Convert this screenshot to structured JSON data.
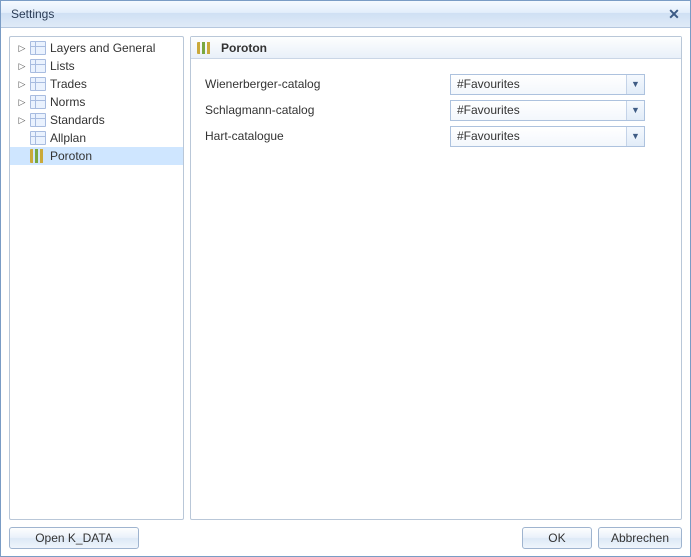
{
  "window": {
    "title": "Settings"
  },
  "tree": {
    "items": [
      {
        "label": "Layers and General",
        "icon": "table",
        "expandable": true,
        "selected": false
      },
      {
        "label": "Lists",
        "icon": "table",
        "expandable": true,
        "selected": false
      },
      {
        "label": "Trades",
        "icon": "table",
        "expandable": true,
        "selected": false
      },
      {
        "label": "Norms",
        "icon": "table",
        "expandable": true,
        "selected": false
      },
      {
        "label": "Standards",
        "icon": "table",
        "expandable": true,
        "selected": false
      },
      {
        "label": "Allplan",
        "icon": "table",
        "expandable": false,
        "selected": false
      },
      {
        "label": "Poroton",
        "icon": "bars",
        "expandable": false,
        "selected": true
      }
    ]
  },
  "content": {
    "heading": "Poroton",
    "rows": [
      {
        "label": "Wienerberger-catalog",
        "value": "#Favourites"
      },
      {
        "label": "Schlagmann-catalog",
        "value": "#Favourites"
      },
      {
        "label": "Hart-catalogue",
        "value": "#Favourites"
      }
    ]
  },
  "footer": {
    "open_kdata": "Open K_DATA",
    "ok": "OK",
    "cancel": "Abbrechen"
  }
}
